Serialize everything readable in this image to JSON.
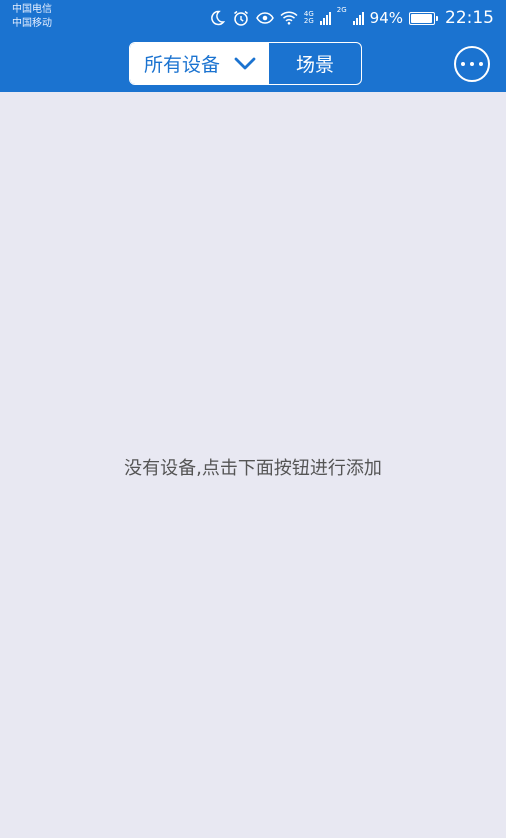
{
  "status_bar": {
    "carrier_1": "中国电信",
    "carrier_2": "中国移动",
    "icons": [
      "moon-icon",
      "alarm-icon",
      "eye-icon",
      "wifi-icon",
      "signal-icon",
      "signal-icon"
    ],
    "net_tag_1": [
      "4G",
      "2G"
    ],
    "net_tag_2": "2G",
    "battery_percent": "94%",
    "battery_level": 0.94,
    "time": "22:15"
  },
  "header": {
    "filter_label": "所有设备",
    "scene_tab": "场景",
    "more_icon": "more-icon"
  },
  "main": {
    "empty_message": "没有设备,点击下面按钮进行添加"
  },
  "colors": {
    "primary": "#1b73d0",
    "background": "#e8e8f2",
    "text_muted": "#555555"
  }
}
